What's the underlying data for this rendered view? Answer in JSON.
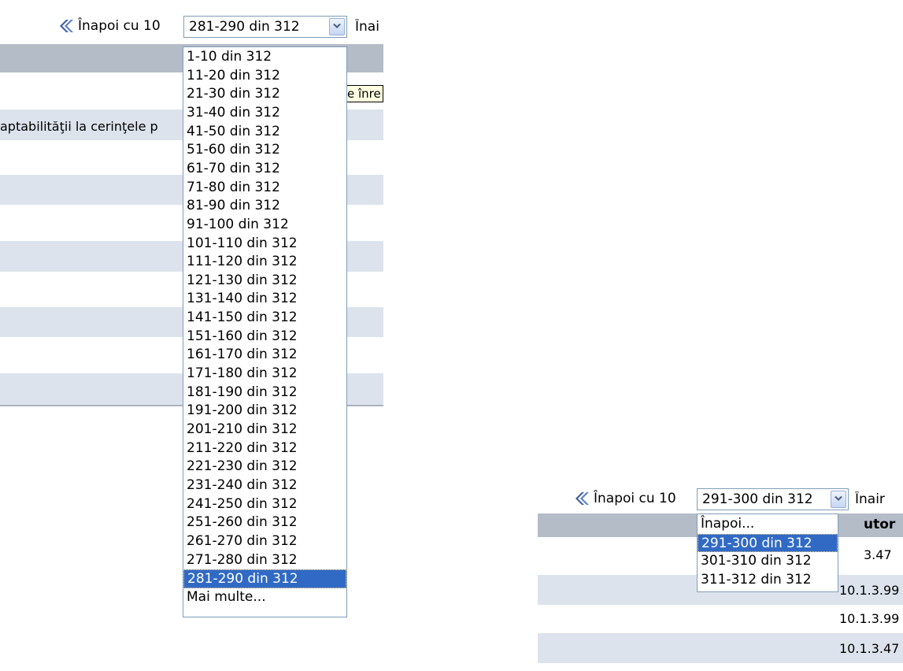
{
  "left": {
    "back_label": "Înapoi cu 10",
    "selected_range": "281-290 din 312",
    "next_label": "Înai",
    "row_text": "aptabilităţii la cerinţele p",
    "tooltip_text": "e înre",
    "options": [
      "1-10 din 312",
      "11-20 din 312",
      "21-30 din 312",
      "31-40 din 312",
      "41-50 din 312",
      "51-60 din 312",
      "61-70 din 312",
      "71-80 din 312",
      "81-90 din 312",
      "91-100 din 312",
      "101-110 din 312",
      "111-120 din 312",
      "121-130 din 312",
      "131-140 din 312",
      "141-150 din 312",
      "151-160 din 312",
      "161-170 din 312",
      "171-180 din 312",
      "181-190 din 312",
      "191-200 din 312",
      "201-210 din 312",
      "211-220 din 312",
      "221-230 din 312",
      "231-240 din 312",
      "241-250 din 312",
      "251-260 din 312",
      "261-270 din 312",
      "271-280 din 312",
      "281-290 din 312",
      "Mai multe..."
    ],
    "selected_option_index": 28
  },
  "right": {
    "back_label": "Înapoi cu 10",
    "selected_range": "291-300 din 312",
    "next_label": "Înair",
    "header_text": "utor",
    "options": [
      "Înapoi...",
      "291-300 din 312",
      "301-310 din 312",
      "311-312 din 312"
    ],
    "selected_option_index": 1,
    "cells": [
      "3.47",
      "10.1.3.99",
      "10.1.3.99",
      "10.1.3.47"
    ]
  },
  "colors": {
    "header_band": "#b4bcc8",
    "row_band": "#dde3ec",
    "selection": "#316ac5",
    "select_border": "#7f9db9",
    "tooltip_bg": "#ffffe1",
    "chevron": "#3f5fa8"
  }
}
